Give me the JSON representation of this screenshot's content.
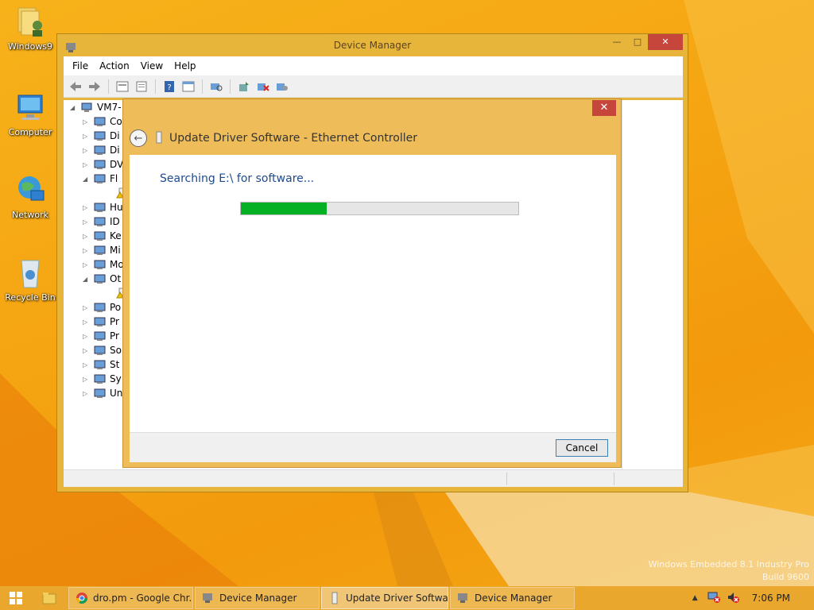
{
  "desktop": {
    "icons": [
      {
        "label": "Windows9"
      },
      {
        "label": "Computer"
      },
      {
        "label": "Network"
      },
      {
        "label": "Recycle Bin"
      }
    ],
    "watermark_line1": "Windows Embedded 8.1 Industry Pro",
    "watermark_line2": "Build 9600"
  },
  "device_manager": {
    "title": "Device Manager",
    "menu": [
      "File",
      "Action",
      "View",
      "Help"
    ],
    "tree_root": "VM7-",
    "tree_items": [
      {
        "label": "Co",
        "expanded": false
      },
      {
        "label": "Di",
        "expanded": false
      },
      {
        "label": "Di",
        "expanded": false
      },
      {
        "label": "DV",
        "expanded": false
      },
      {
        "label": "Fl",
        "expanded": true
      },
      {
        "label": "",
        "expanded": null
      },
      {
        "label": "Hu",
        "expanded": false
      },
      {
        "label": "ID",
        "expanded": false
      },
      {
        "label": "Ke",
        "expanded": false
      },
      {
        "label": "Mi",
        "expanded": false
      },
      {
        "label": "Mo",
        "expanded": false
      },
      {
        "label": "Ot",
        "expanded": true
      },
      {
        "label": "",
        "expanded": null
      },
      {
        "label": "Po",
        "expanded": false
      },
      {
        "label": "Pr",
        "expanded": false
      },
      {
        "label": "Pr",
        "expanded": false
      },
      {
        "label": "So",
        "expanded": false
      },
      {
        "label": "St",
        "expanded": false
      },
      {
        "label": "Sy",
        "expanded": false
      },
      {
        "label": "Un",
        "expanded": false
      }
    ]
  },
  "update_driver": {
    "title": "Update Driver Software - Ethernet Controller",
    "status": "Searching E:\\ for software...",
    "progress": 0.31,
    "cancel_label": "Cancel",
    "close_label": "✕"
  },
  "taskbar": {
    "items": [
      {
        "label": "dro.pm - Google Chr...",
        "icon": "chrome-icon",
        "active": false
      },
      {
        "label": "Device Manager",
        "icon": "device-manager-icon",
        "active": false
      },
      {
        "label": "Update Driver Softwa...",
        "icon": "driver-icon",
        "active": true
      },
      {
        "label": "Device Manager",
        "icon": "device-manager-icon",
        "active": false
      }
    ],
    "clock": "7:06 PM"
  },
  "colors": {
    "accent": "#f5a512",
    "progress_fill": "#06b025",
    "close_button": "#c7463b",
    "link_blue": "#1e4b8e"
  }
}
